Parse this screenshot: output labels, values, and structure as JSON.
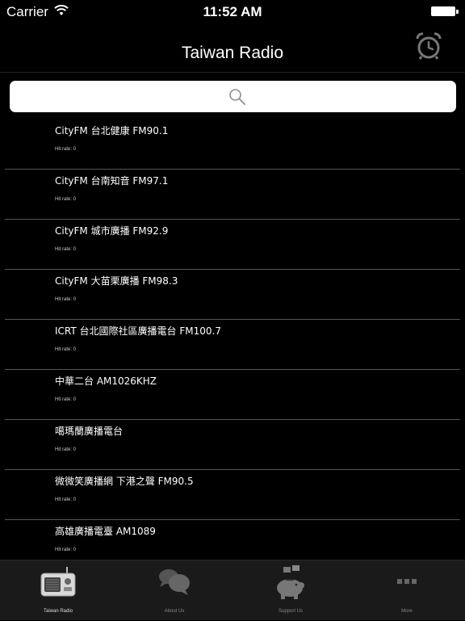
{
  "status_bar": {
    "carrier": "Carrier",
    "time": "11:52 AM"
  },
  "nav": {
    "title": "Taiwan Radio"
  },
  "search": {
    "placeholder": ""
  },
  "stations": [
    {
      "name": "CityFM 台北健康 FM90.1",
      "hit": "Hit rate: 0"
    },
    {
      "name": "CityFM 台南知音 FM97.1",
      "hit": "Hit rate: 0"
    },
    {
      "name": "CityFM 城市廣播 FM92.9",
      "hit": "Hit rate: 0"
    },
    {
      "name": "CityFM 大苗栗廣播 FM98.3",
      "hit": "Hit rate: 0"
    },
    {
      "name": "ICRT 台北國際社區廣播電台 FM100.7",
      "hit": "Hit rate: 0"
    },
    {
      "name": "中華二台 AM1026KHZ",
      "hit": "Hit rate: 0"
    },
    {
      "name": "噶瑪蘭廣播電台",
      "hit": "Hit rate: 0"
    },
    {
      "name": "微微笑廣播網 下港之聲 FM90.5",
      "hit": "Hit rate: 0"
    },
    {
      "name": "高雄廣播電臺 AM1089",
      "hit": "Hit rate: 0"
    }
  ],
  "tabs": [
    {
      "label": "Taiwan Radio",
      "icon": "radio-icon",
      "active": true
    },
    {
      "label": "About Us",
      "icon": "chat-bubbles-icon",
      "active": false
    },
    {
      "label": "Support Us",
      "icon": "piggy-bank-icon",
      "active": false
    },
    {
      "label": "More",
      "icon": "more-icon",
      "active": false
    }
  ],
  "colors": {
    "background": "#000000",
    "tab_bar": "#1a1a1a",
    "separator": "#555555"
  }
}
